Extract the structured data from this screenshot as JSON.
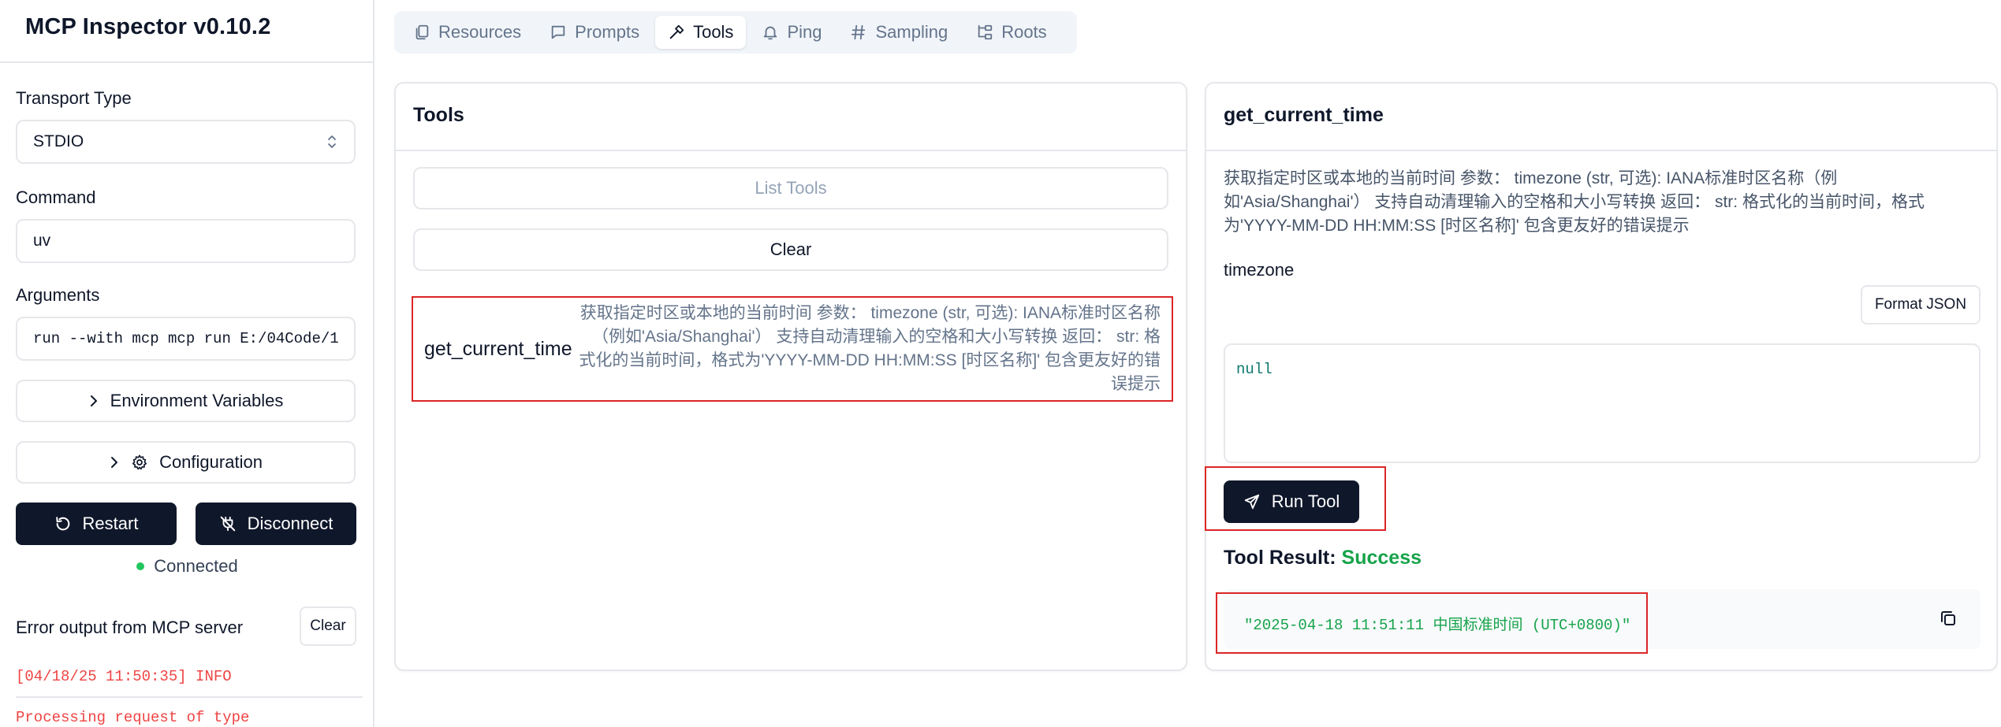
{
  "app": {
    "title": "MCP Inspector v0.10.2"
  },
  "sidebar": {
    "transport_label": "Transport Type",
    "transport_value": "STDIO",
    "command_label": "Command",
    "command_value": "uv",
    "arguments_label": "Arguments",
    "arguments_value": "run --with mcp mcp run E:/04Code/1",
    "env_vars_label": "Environment Variables",
    "configuration_label": "Configuration",
    "restart_label": "Restart",
    "disconnect_label": "Disconnect",
    "status_text": "Connected",
    "status_color": "#22c55e",
    "error_title": "Error output from MCP server",
    "clear_label": "Clear",
    "logs": [
      "[04/18/25 11:50:35] INFO",
      "Processing request of type"
    ]
  },
  "tabs": [
    {
      "label": "Resources",
      "icon": "files-icon"
    },
    {
      "label": "Prompts",
      "icon": "message-icon"
    },
    {
      "label": "Tools",
      "icon": "hammer-icon",
      "active": true
    },
    {
      "label": "Ping",
      "icon": "bell-icon"
    },
    {
      "label": "Sampling",
      "icon": "hash-icon"
    },
    {
      "label": "Roots",
      "icon": "folder-tree-icon"
    }
  ],
  "tools_panel": {
    "title": "Tools",
    "list_tools_label": "List Tools",
    "clear_label": "Clear",
    "items": [
      {
        "name": "get_current_time",
        "description": "获取指定时区或本地的当前时间 参数： timezone (str, 可选): IANA标准时区名称（例如'Asia/Shanghai'） 支持自动清理输入的空格和大小写转换 返回： str: 格式化的当前时间，格式为'YYYY-MM-DD HH:MM:SS [时区名称]' 包含更友好的错误提示"
      }
    ]
  },
  "detail_panel": {
    "title": "get_current_time",
    "description": "获取指定时区或本地的当前时间 参数： timezone (str, 可选): IANA标准时区名称（例如'Asia/Shanghai'） 支持自动清理输入的空格和大小写转换 返回： str: 格式化的当前时间，格式为'YYYY-MM-DD HH:MM:SS [时区名称]' 包含更友好的错误提示",
    "param_label": "timezone",
    "format_json_label": "Format JSON",
    "param_value": "null",
    "run_label": "Run Tool",
    "result_label": "Tool Result:",
    "result_status": "Success",
    "result_status_color": "#16a34a",
    "result_value": "\"2025-04-18 11:51:11 中国标准时间 (UTC+0800)\""
  }
}
